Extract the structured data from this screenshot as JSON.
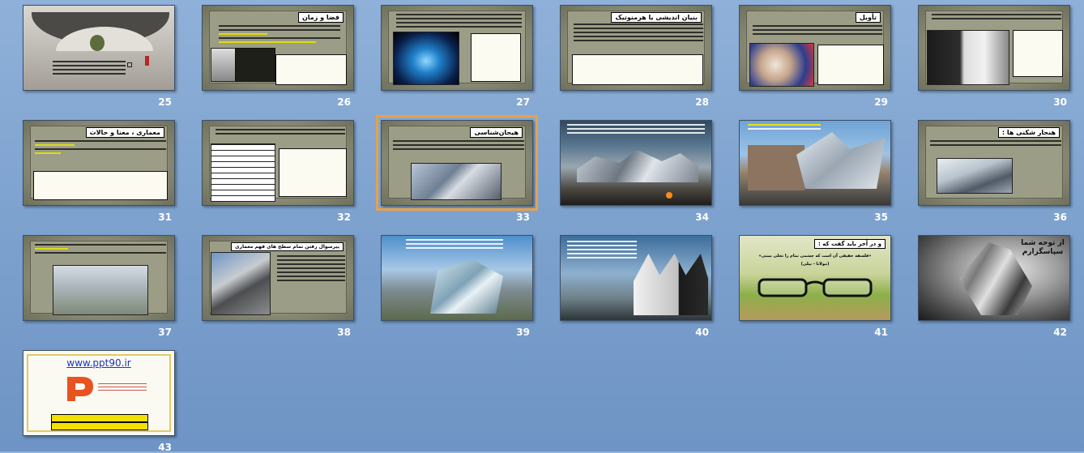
{
  "view": "slide-sorter",
  "selected_slide": "33",
  "slides": {
    "s25": {
      "number": "25"
    },
    "s26": {
      "number": "26",
      "title": "فضا و زمان"
    },
    "s27": {
      "number": "27"
    },
    "s28": {
      "number": "28",
      "title": "بنیان اندیشی یا هرمنوتیک"
    },
    "s29": {
      "number": "29",
      "title": "تأویل"
    },
    "s30": {
      "number": "30"
    },
    "s31": {
      "number": "31",
      "title": "معماری ، معنا و حالات"
    },
    "s32": {
      "number": "32"
    },
    "s33": {
      "number": "33",
      "title": "هیجان‌شناسی"
    },
    "s34": {
      "number": "34"
    },
    "s35": {
      "number": "35"
    },
    "s36": {
      "number": "36",
      "title": "هنجار شکنی ها :"
    },
    "s37": {
      "number": "37"
    },
    "s38": {
      "number": "38",
      "title": "پیرسوال رفتن تمام سطح های فهم معماری"
    },
    "s39": {
      "number": "39"
    },
    "s40": {
      "number": "40"
    },
    "s41": {
      "number": "41",
      "title": "و در آخر باید گفت که :",
      "subtitle": "«فلسفه حقیقی آن است که چشمی تمام را تجلی ببینی»",
      "sub2": "(مولانا - بیلی)"
    },
    "s42": {
      "number": "42",
      "text": "از توجه شما سپاسگزارم"
    },
    "s43": {
      "number": "43",
      "url": "www.ppt90.ir"
    }
  },
  "colors": {
    "background": "#7fa3cf",
    "selection": "#e7a14a",
    "parchment": "#9c9d86"
  }
}
